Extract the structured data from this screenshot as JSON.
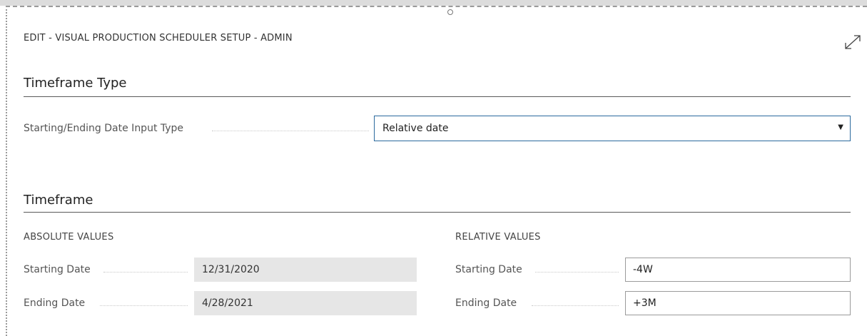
{
  "page": {
    "title": "EDIT - VISUAL PRODUCTION SCHEDULER SETUP - ADMIN"
  },
  "icons": {
    "expand": "expand-diagonal-arrows-icon"
  },
  "timeframe_type": {
    "header": "Timeframe Type",
    "input_type_label": "Starting/Ending Date Input Type",
    "input_type_value": "Relative date"
  },
  "timeframe": {
    "header": "Timeframe",
    "absolute": {
      "caption": "ABSOLUTE VALUES",
      "starting_date_label": "Starting Date",
      "starting_date_value": "12/31/2020",
      "ending_date_label": "Ending Date",
      "ending_date_value": "4/28/2021"
    },
    "relative": {
      "caption": "RELATIVE VALUES",
      "starting_date_label": "Starting Date",
      "starting_date_value": "-4W",
      "ending_date_label": "Ending Date",
      "ending_date_value": "+3M"
    }
  },
  "colors": {
    "accent_border": "#2b6a9e",
    "readonly_bg": "#e6e6e6"
  }
}
